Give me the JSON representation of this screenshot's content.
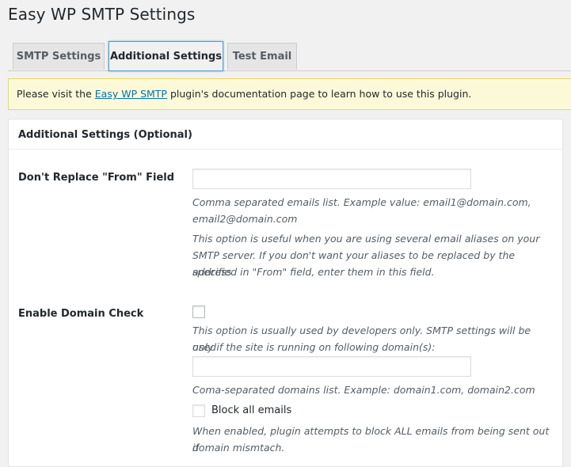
{
  "page": {
    "title": "Easy WP SMTP Settings"
  },
  "tabs": [
    {
      "label": "SMTP Settings"
    },
    {
      "label": "Additional Settings"
    },
    {
      "label": "Test Email"
    }
  ],
  "notice": {
    "prefix": "Please visit the ",
    "link_text": "Easy WP SMTP",
    "suffix": " plugin's documentation page to learn how to use this plugin."
  },
  "section": {
    "title": "Additional Settings (Optional)"
  },
  "dont_replace_from": {
    "label": "Don't Replace \"From\" Field",
    "value": "",
    "desc_1_line_1": "Comma separated emails list. Example value: email1@domain.com,",
    "desc_1_line_2": "email2@domain.com",
    "desc_2_line_1": "This option is useful when you are using several email aliases on your",
    "desc_2_line_2": "SMTP server. If you don't want your aliases to be replaced by the address",
    "desc_2_line_3": "specified in \"From\" field, enter them in this field."
  },
  "domain_check": {
    "label": "Enable Domain Check",
    "desc_line_1": "This option is usually used by developers only. SMTP settings will be used",
    "desc_line_2": "only if the site is running on following domain(s):",
    "domains_value": "",
    "domains_desc": "Coma-separated domains list. Example: domain1.com, domain2.com",
    "block_label": "Block all emails",
    "block_desc_line_1": "When enabled, plugin attempts to block ALL emails from being sent out if",
    "block_desc_line_2": "domain mismtach."
  },
  "colors": {
    "link": "#0073aa",
    "notice_bg": "#fcf9d8",
    "notice_border": "#e6db55",
    "active_tab_focus": "#5b9dd9"
  }
}
